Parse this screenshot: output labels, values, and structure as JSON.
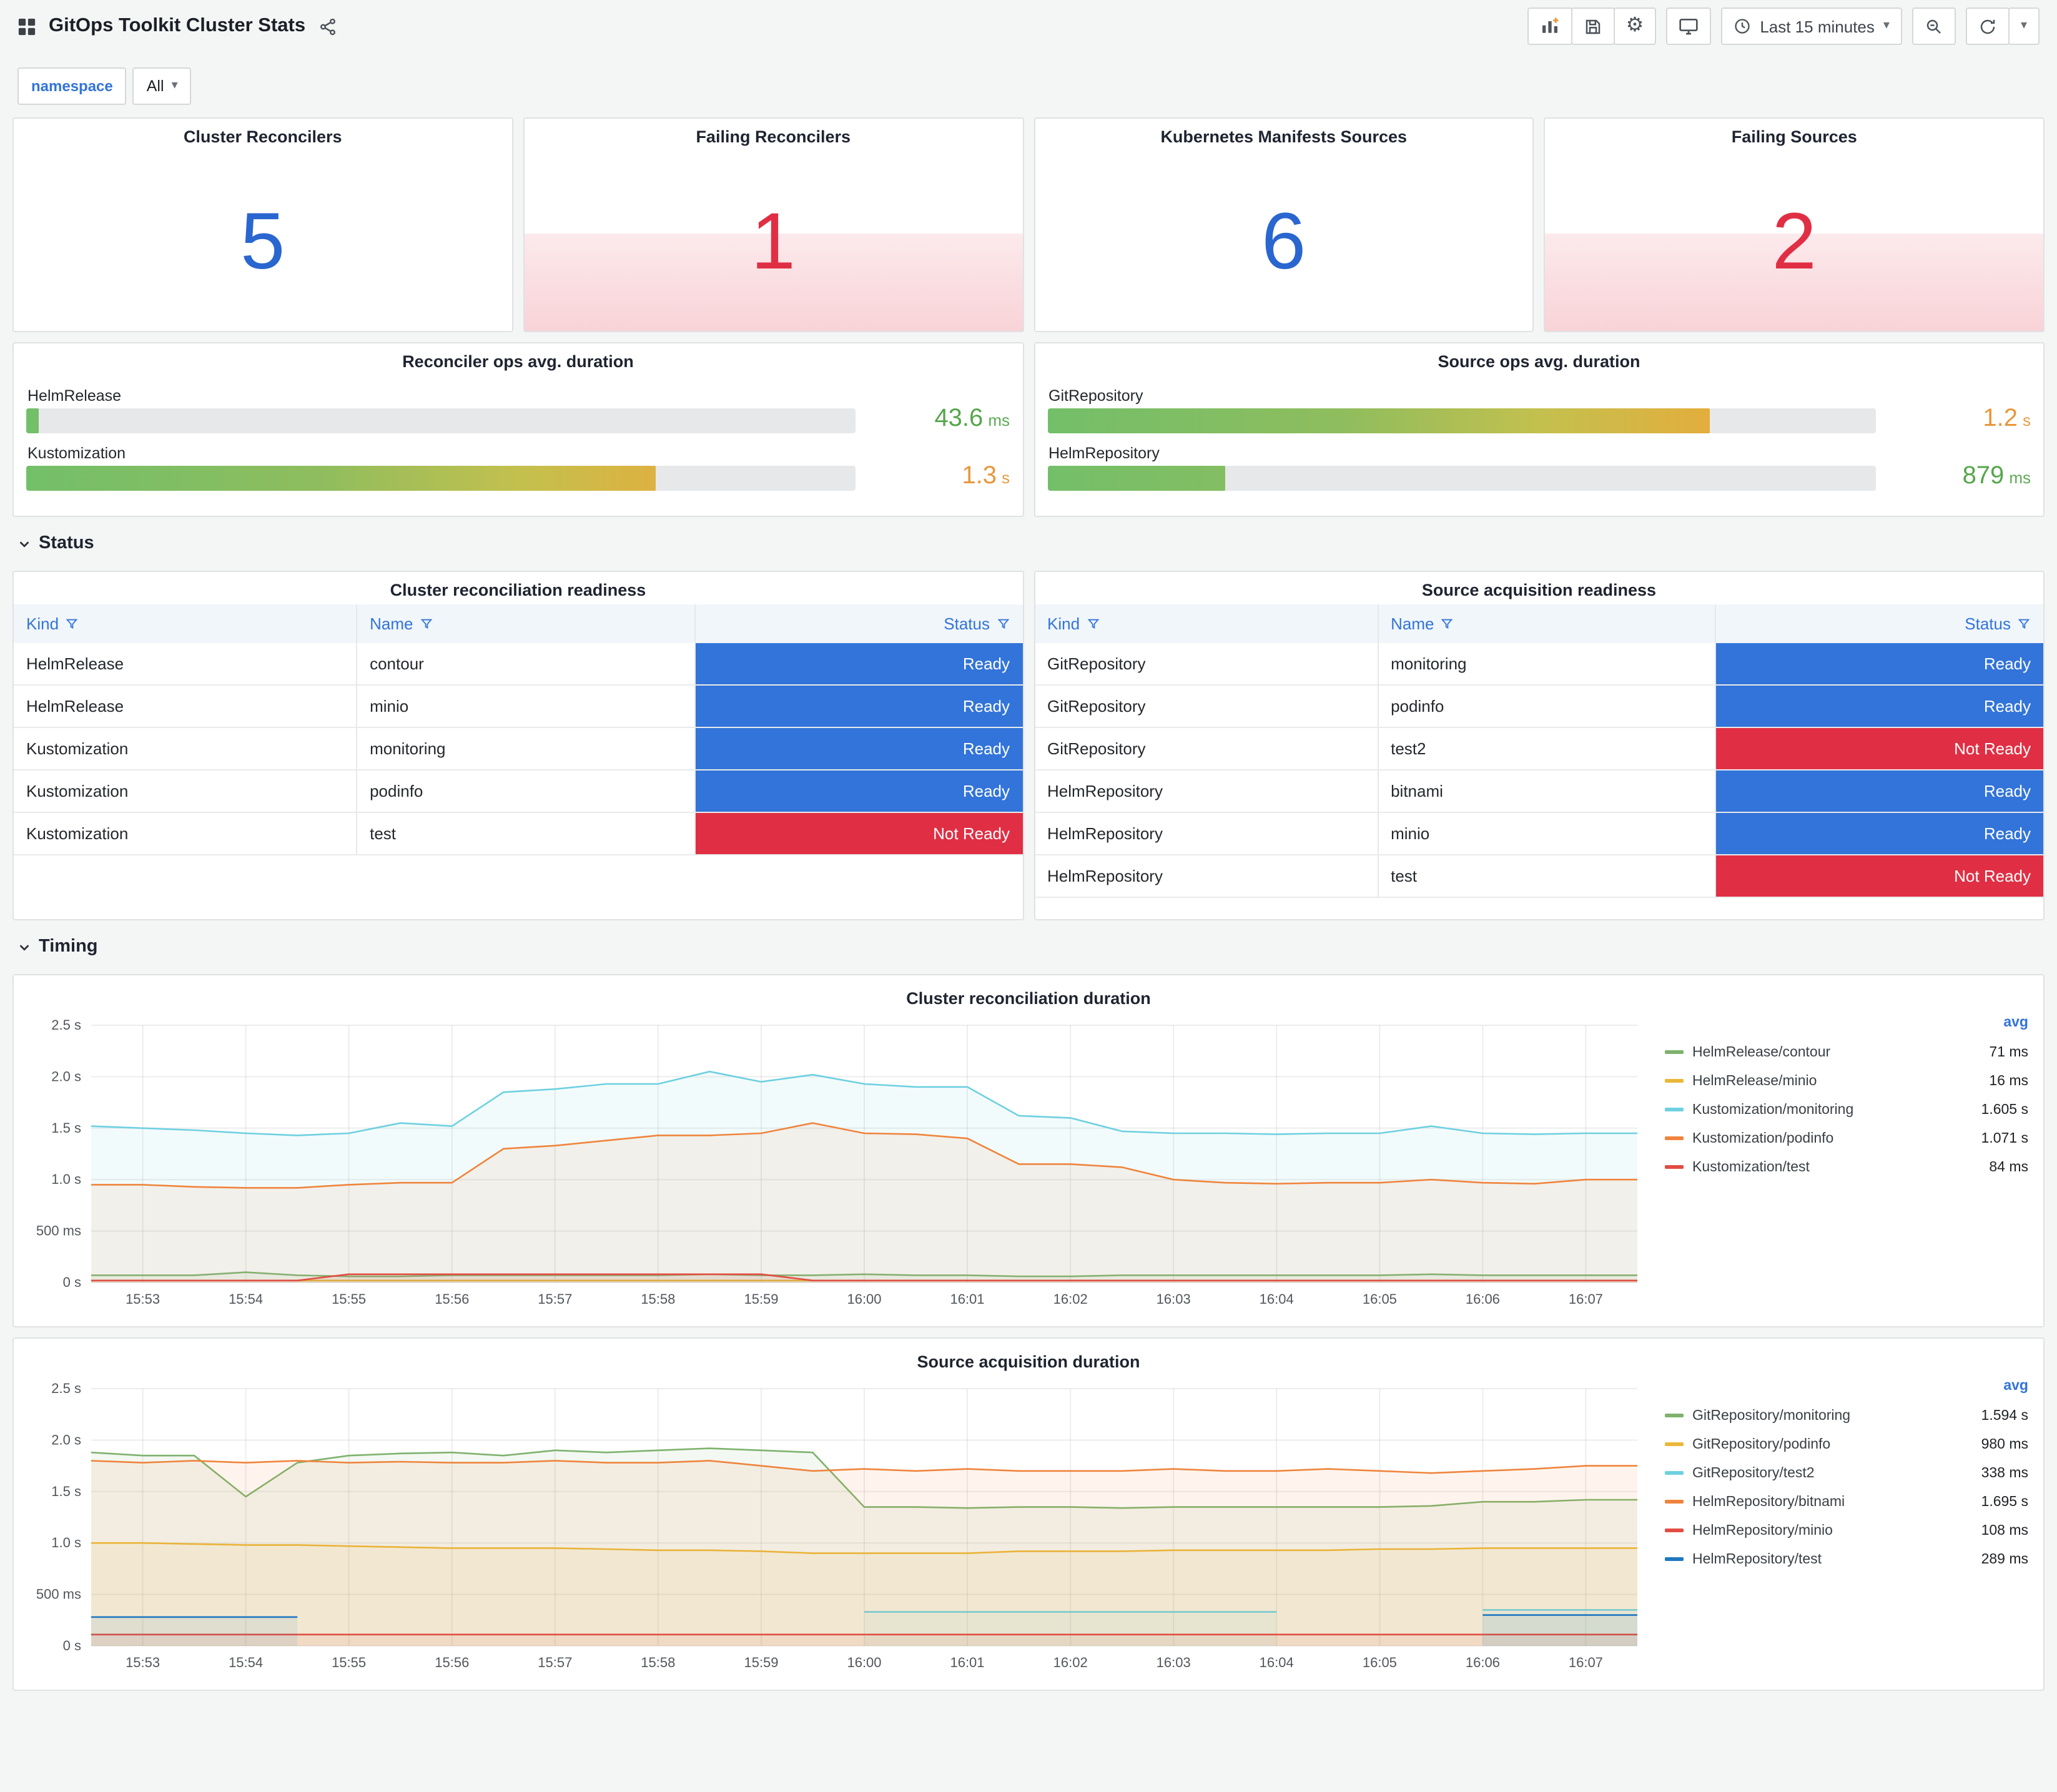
{
  "colors": {
    "blue": "#2a66cf",
    "red": "#e02f44",
    "ready_bg": "#3274d9",
    "not_ready_bg": "#e02f44"
  },
  "header": {
    "title": "GitOps Toolkit Cluster Stats",
    "time_range_label": "Last 15 minutes"
  },
  "variables": {
    "namespace_label": "namespace",
    "namespace_value": "All"
  },
  "sections": {
    "status": "Status",
    "timing": "Timing"
  },
  "stat_panels": [
    {
      "title": "Cluster Reconcilers",
      "value": "5",
      "state": "ok"
    },
    {
      "title": "Failing Reconcilers",
      "value": "1",
      "state": "alert"
    },
    {
      "title": "Kubernetes Manifests Sources",
      "value": "6",
      "state": "ok"
    },
    {
      "title": "Failing Sources",
      "value": "2",
      "state": "alert"
    }
  ],
  "gauge_panels": [
    {
      "title": "Reconciler ops avg. duration",
      "rows": [
        {
          "label": "HelmRelease",
          "value": "43.6",
          "unit": "ms",
          "pct": 1.5,
          "value_color": "#56a64b"
        },
        {
          "label": "Kustomization",
          "value": "1.3",
          "unit": "s",
          "pct": 76,
          "value_color": "#e8973a"
        }
      ]
    },
    {
      "title": "Source ops avg. duration",
      "rows": [
        {
          "label": "GitRepository",
          "value": "1.2",
          "unit": "s",
          "pct": 80,
          "value_color": "#e8973a"
        },
        {
          "label": "HelmRepository",
          "value": "879",
          "unit": "ms",
          "pct": 21.5,
          "value_color": "#56a64b"
        }
      ]
    }
  ],
  "tables": [
    {
      "title": "Cluster reconciliation readiness",
      "columns": [
        "Kind",
        "Name",
        "Status"
      ],
      "rows": [
        [
          "HelmRelease",
          "contour",
          "Ready"
        ],
        [
          "HelmRelease",
          "minio",
          "Ready"
        ],
        [
          "Kustomization",
          "monitoring",
          "Ready"
        ],
        [
          "Kustomization",
          "podinfo",
          "Ready"
        ],
        [
          "Kustomization",
          "test",
          "Not Ready"
        ]
      ]
    },
    {
      "title": "Source acquisition readiness",
      "columns": [
        "Kind",
        "Name",
        "Status"
      ],
      "rows": [
        [
          "GitRepository",
          "monitoring",
          "Ready"
        ],
        [
          "GitRepository",
          "podinfo",
          "Ready"
        ],
        [
          "GitRepository",
          "test2",
          "Not Ready"
        ],
        [
          "HelmRepository",
          "bitnami",
          "Ready"
        ],
        [
          "HelmRepository",
          "minio",
          "Ready"
        ],
        [
          "HelmRepository",
          "test",
          "Not Ready"
        ]
      ]
    }
  ],
  "chart_data": [
    {
      "type": "line",
      "title": "Cluster reconciliation duration",
      "ylim": [
        0,
        2.5
      ],
      "legend_header": "avg",
      "legend_position": "right",
      "grid": true,
      "y_ticks": [
        {
          "v": 0,
          "label": "0 s"
        },
        {
          "v": 0.5,
          "label": "500 ms"
        },
        {
          "v": 1,
          "label": "1.0 s"
        },
        {
          "v": 1.5,
          "label": "1.5 s"
        },
        {
          "v": 2,
          "label": "2.0 s"
        },
        {
          "v": 2.5,
          "label": "2.5 s"
        }
      ],
      "x_ticks": [
        {
          "i": 1,
          "label": "15:53"
        },
        {
          "i": 3,
          "label": "15:54"
        },
        {
          "i": 5,
          "label": "15:55"
        },
        {
          "i": 7,
          "label": "15:56"
        },
        {
          "i": 9,
          "label": "15:57"
        },
        {
          "i": 11,
          "label": "15:58"
        },
        {
          "i": 13,
          "label": "15:59"
        },
        {
          "i": 15,
          "label": "16:00"
        },
        {
          "i": 17,
          "label": "16:01"
        },
        {
          "i": 19,
          "label": "16:02"
        },
        {
          "i": 21,
          "label": "16:03"
        },
        {
          "i": 23,
          "label": "16:04"
        },
        {
          "i": 25,
          "label": "16:05"
        },
        {
          "i": 27,
          "label": "16:06"
        },
        {
          "i": 29,
          "label": "16:07"
        }
      ],
      "series": [
        {
          "name": "HelmRelease/contour",
          "avg": "71 ms",
          "color": "#7EB26D",
          "values": [
            0.07,
            0.07,
            0.07,
            0.1,
            0.07,
            0.06,
            0.06,
            0.07,
            0.07,
            0.07,
            0.07,
            0.07,
            0.08,
            0.07,
            0.07,
            0.08,
            0.07,
            0.07,
            0.06,
            0.06,
            0.07,
            0.07,
            0.07,
            0.07,
            0.07,
            0.07,
            0.08,
            0.07,
            0.07,
            0.07,
            0.07
          ]
        },
        {
          "name": "HelmRelease/minio",
          "avg": "16 ms",
          "color": "#EAB839",
          "values": [
            0.02,
            0.02,
            0.02,
            0.02,
            0.02,
            0.02,
            0.02,
            0.02,
            0.02,
            0.02,
            0.02,
            0.02,
            0.02,
            0.02,
            0.02,
            0.02,
            0.02,
            0.02,
            0.02,
            0.02,
            0.02,
            0.02,
            0.02,
            0.02,
            0.02,
            0.02,
            0.02,
            0.02,
            0.02,
            0.02,
            0.02
          ]
        },
        {
          "name": "Kustomization/monitoring",
          "avg": "1.605 s",
          "color": "#6ED0E0",
          "values": [
            1.52,
            1.5,
            1.48,
            1.45,
            1.43,
            1.45,
            1.55,
            1.52,
            1.85,
            1.88,
            1.93,
            1.93,
            2.05,
            1.95,
            2.02,
            1.93,
            1.9,
            1.9,
            1.62,
            1.6,
            1.47,
            1.45,
            1.45,
            1.44,
            1.45,
            1.45,
            1.52,
            1.45,
            1.44,
            1.45,
            1.45
          ]
        },
        {
          "name": "Kustomization/podinfo",
          "avg": "1.071 s",
          "color": "#EF843C",
          "values": [
            0.95,
            0.95,
            0.93,
            0.92,
            0.92,
            0.95,
            0.97,
            0.97,
            1.3,
            1.33,
            1.38,
            1.43,
            1.43,
            1.45,
            1.55,
            1.45,
            1.44,
            1.4,
            1.15,
            1.15,
            1.12,
            1.0,
            0.97,
            0.96,
            0.97,
            0.97,
            1.0,
            0.97,
            0.96,
            1.0,
            1.0
          ]
        },
        {
          "name": "Kustomization/test",
          "avg": "84 ms",
          "color": "#E24D42",
          "values": [
            0.02,
            0.02,
            0.02,
            0.02,
            0.02,
            0.08,
            0.08,
            0.08,
            0.08,
            0.08,
            0.08,
            0.08,
            0.08,
            0.08,
            0.02,
            0.02,
            0.02,
            0.02,
            0.02,
            0.02,
            0.02,
            0.02,
            0.02,
            0.02,
            0.02,
            0.02,
            0.02,
            0.02,
            0.02,
            0.02,
            0.02
          ]
        }
      ]
    },
    {
      "type": "line",
      "title": "Source acquisition duration",
      "ylim": [
        0,
        2.5
      ],
      "legend_header": "avg",
      "legend_position": "right",
      "grid": true,
      "y_ticks": [
        {
          "v": 0,
          "label": "0 s"
        },
        {
          "v": 0.5,
          "label": "500 ms"
        },
        {
          "v": 1,
          "label": "1.0 s"
        },
        {
          "v": 1.5,
          "label": "1.5 s"
        },
        {
          "v": 2,
          "label": "2.0 s"
        },
        {
          "v": 2.5,
          "label": "2.5 s"
        }
      ],
      "x_ticks": [
        {
          "i": 1,
          "label": "15:53"
        },
        {
          "i": 3,
          "label": "15:54"
        },
        {
          "i": 5,
          "label": "15:55"
        },
        {
          "i": 7,
          "label": "15:56"
        },
        {
          "i": 9,
          "label": "15:57"
        },
        {
          "i": 11,
          "label": "15:58"
        },
        {
          "i": 13,
          "label": "15:59"
        },
        {
          "i": 15,
          "label": "16:00"
        },
        {
          "i": 17,
          "label": "16:01"
        },
        {
          "i": 19,
          "label": "16:02"
        },
        {
          "i": 21,
          "label": "16:03"
        },
        {
          "i": 23,
          "label": "16:04"
        },
        {
          "i": 25,
          "label": "16:05"
        },
        {
          "i": 27,
          "label": "16:06"
        },
        {
          "i": 29,
          "label": "16:07"
        }
      ],
      "series": [
        {
          "name": "GitRepository/monitoring",
          "avg": "1.594 s",
          "color": "#7EB26D",
          "values": [
            1.88,
            1.85,
            1.85,
            1.45,
            1.78,
            1.85,
            1.87,
            1.88,
            1.85,
            1.9,
            1.88,
            1.9,
            1.92,
            1.9,
            1.88,
            1.35,
            1.35,
            1.34,
            1.35,
            1.35,
            1.34,
            1.35,
            1.35,
            1.35,
            1.35,
            1.35,
            1.36,
            1.4,
            1.4,
            1.42,
            1.42
          ]
        },
        {
          "name": "GitRepository/podinfo",
          "avg": "980 ms",
          "color": "#EAB839",
          "values": [
            1.0,
            1.0,
            0.99,
            0.98,
            0.98,
            0.97,
            0.96,
            0.95,
            0.95,
            0.95,
            0.94,
            0.93,
            0.93,
            0.92,
            0.9,
            0.9,
            0.9,
            0.9,
            0.92,
            0.92,
            0.92,
            0.93,
            0.93,
            0.93,
            0.93,
            0.94,
            0.94,
            0.95,
            0.95,
            0.95,
            0.95
          ]
        },
        {
          "name": "GitRepository/test2",
          "avg": "338 ms",
          "color": "#6ED0E0",
          "values": [
            null,
            null,
            null,
            null,
            null,
            null,
            null,
            null,
            null,
            null,
            null,
            null,
            null,
            null,
            null,
            0.33,
            0.33,
            0.33,
            0.33,
            0.33,
            0.33,
            0.33,
            0.33,
            0.33,
            null,
            null,
            null,
            0.35,
            0.35,
            0.35,
            0.35
          ]
        },
        {
          "name": "HelmRepository/bitnami",
          "avg": "1.695 s",
          "color": "#EF843C",
          "values": [
            1.8,
            1.78,
            1.8,
            1.78,
            1.8,
            1.78,
            1.79,
            1.78,
            1.78,
            1.8,
            1.78,
            1.78,
            1.8,
            1.75,
            1.7,
            1.72,
            1.7,
            1.72,
            1.7,
            1.7,
            1.7,
            1.72,
            1.7,
            1.7,
            1.72,
            1.7,
            1.68,
            1.7,
            1.72,
            1.75,
            1.75
          ]
        },
        {
          "name": "HelmRepository/minio",
          "avg": "108 ms",
          "color": "#E24D42",
          "values": [
            0.11,
            0.11,
            0.11,
            0.11,
            0.11,
            0.11,
            0.11,
            0.11,
            0.11,
            0.11,
            0.11,
            0.11,
            0.11,
            0.11,
            0.11,
            0.11,
            0.11,
            0.11,
            0.11,
            0.11,
            0.11,
            0.11,
            0.11,
            0.11,
            0.11,
            0.11,
            0.11,
            0.11,
            0.11,
            0.11,
            0.11
          ]
        },
        {
          "name": "HelmRepository/test",
          "avg": "289 ms",
          "color": "#1F78C1",
          "values": [
            0.28,
            0.28,
            0.28,
            0.28,
            0.28,
            null,
            null,
            null,
            null,
            null,
            null,
            null,
            null,
            null,
            null,
            null,
            null,
            null,
            null,
            null,
            null,
            null,
            null,
            null,
            null,
            null,
            null,
            0.3,
            0.3,
            0.3,
            0.3
          ]
        }
      ]
    }
  ]
}
